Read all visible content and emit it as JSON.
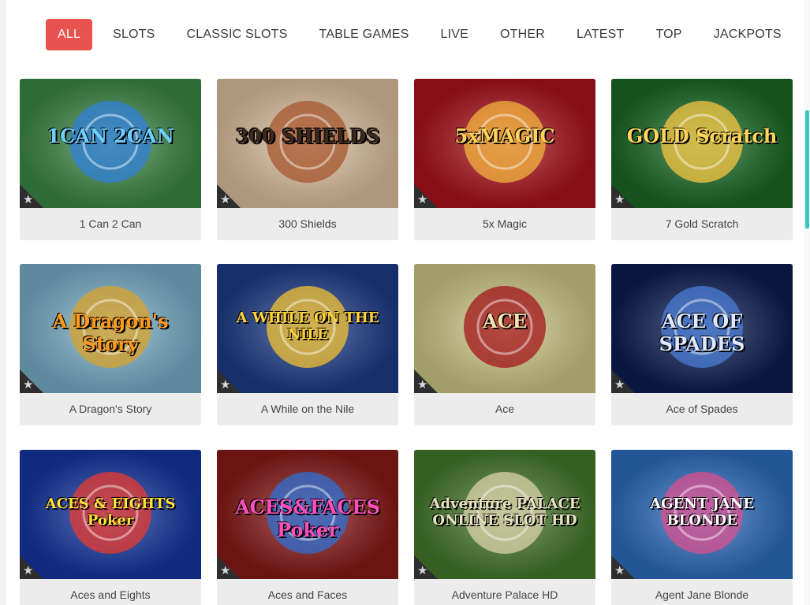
{
  "nav": {
    "items": [
      {
        "label": "ALL",
        "active": true
      },
      {
        "label": "SLOTS",
        "active": false
      },
      {
        "label": "CLASSIC SLOTS",
        "active": false
      },
      {
        "label": "TABLE GAMES",
        "active": false
      },
      {
        "label": "LIVE",
        "active": false
      },
      {
        "label": "OTHER",
        "active": false
      },
      {
        "label": "LATEST",
        "active": false
      },
      {
        "label": "TOP",
        "active": false
      },
      {
        "label": "JACKPOTS",
        "active": false
      }
    ]
  },
  "games": [
    {
      "title": "1 Can 2 Can",
      "art_text": "1CAN 2CAN",
      "bg": "#3f8f4a",
      "accent": "#2f7fd8",
      "art_color": "#6fd0ff"
    },
    {
      "title": "300 Shields",
      "art_text": "300 SHIELDS",
      "bg": "#e8c9a6",
      "accent": "#a5562e",
      "art_color": "#3a2a20"
    },
    {
      "title": "5x Magic",
      "art_text": "5xMAGIC",
      "bg": "#b3121c",
      "accent": "#f2b33d",
      "art_color": "#ffd25a"
    },
    {
      "title": "7 Gold Scratch",
      "art_text": "GOLD Scratch",
      "bg": "#1b6f27",
      "accent": "#f5c542",
      "art_color": "#ffd65c"
    },
    {
      "title": "A Dragon's Story",
      "art_text": "A Dragon's Story",
      "bg": "#7fb8d2",
      "accent": "#d8a22a",
      "art_color": "#ff9a1f"
    },
    {
      "title": "A While on the Nile",
      "art_text": "A WHILE ON THE NILE",
      "bg": "#1f3f8f",
      "accent": "#f1c232",
      "art_color": "#ffd23a"
    },
    {
      "title": "Ace",
      "art_text": "ACE",
      "bg": "#d9d28c",
      "accent": "#a3161c",
      "art_color": "#f5e3b0"
    },
    {
      "title": "Ace of Spades",
      "art_text": "ACE OF SPADES",
      "bg": "#0d1f56",
      "accent": "#4a7cd6",
      "art_color": "#dfe8ff"
    },
    {
      "title": "Aces and Eights",
      "art_text": "ACES & EIGHTS Poker",
      "bg": "#1438a8",
      "accent": "#e83a2e",
      "art_color": "#ffe23a"
    },
    {
      "title": "Aces and Faces",
      "art_text": "ACES&FACES Poker",
      "bg": "#8f1a1a",
      "accent": "#2d6fd2",
      "art_color": "#ff4fbf"
    },
    {
      "title": "Adventure Palace HD",
      "art_text": "Adventure PALACE ONLINE SLOT HD",
      "bg": "#4a7f2e",
      "accent": "#d9d2a8",
      "art_color": "#e8e2c0"
    },
    {
      "title": "Agent Jane Blonde",
      "art_text": "AGENT JANE BLONDE",
      "bg": "#2f72c8",
      "accent": "#d94f8f",
      "art_color": "#ffffff"
    }
  ],
  "icons": {
    "favorite": "star-icon"
  },
  "colors": {
    "accent": "#e8534f",
    "card_bg": "#ececec",
    "text": "#444444"
  }
}
